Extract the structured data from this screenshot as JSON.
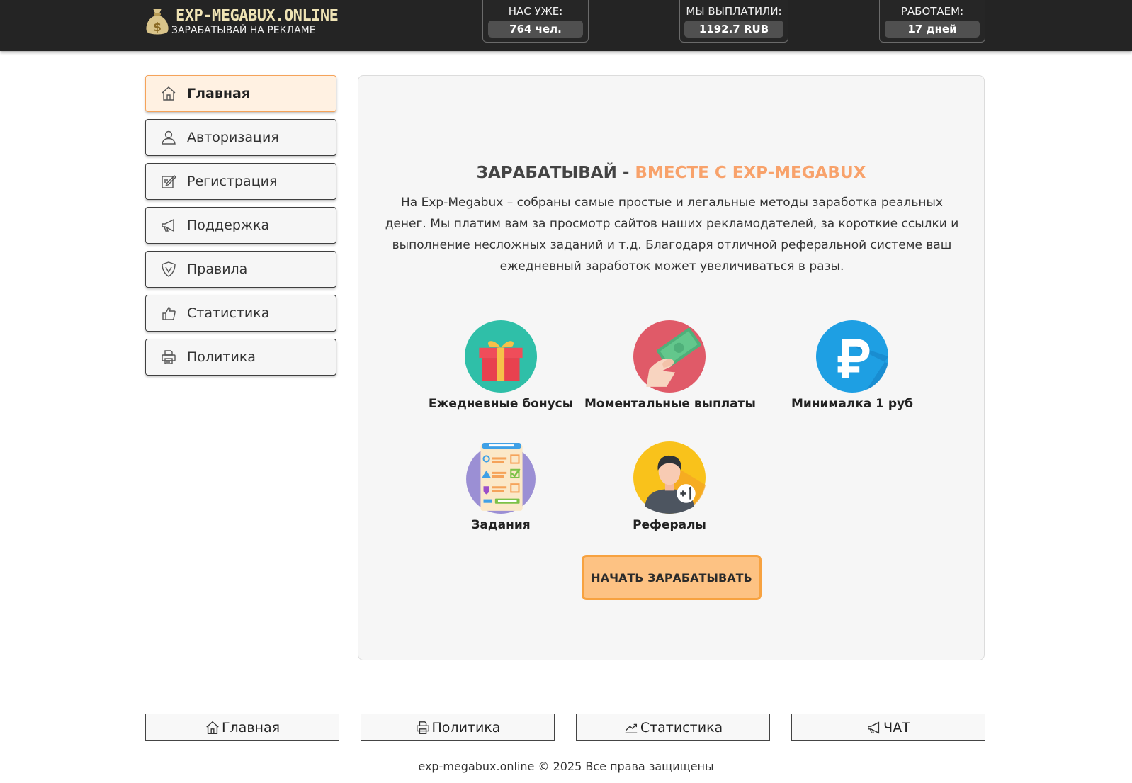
{
  "header": {
    "logo_title": "EXP-MEGABUX.ONLINE",
    "logo_subtitle": "ЗАРАБАТЫВАЙ НА РЕКЛАМЕ",
    "stats": [
      {
        "label": "НАС УЖЕ:",
        "value": "764 чел."
      },
      {
        "label": "МЫ ВЫПЛАТИЛИ:",
        "value": "1192.7 RUB"
      },
      {
        "label": "РАБОТАЕМ:",
        "value": "17 дней"
      }
    ]
  },
  "sidebar": {
    "items": [
      {
        "label": "Главная",
        "icon": "home-icon",
        "active": true
      },
      {
        "label": "Авторизация",
        "icon": "user-icon"
      },
      {
        "label": "Регистрация",
        "icon": "edit-icon"
      },
      {
        "label": "Поддержка",
        "icon": "megaphone-icon"
      },
      {
        "label": "Правила",
        "icon": "shield-icon"
      },
      {
        "label": "Статистика",
        "icon": "thumbs-up-icon"
      },
      {
        "label": "Политика",
        "icon": "printer-icon"
      }
    ]
  },
  "main": {
    "headline_dark": "ЗАРАБАТЫВАЙ - ",
    "headline_accent": "ВМЕСТЕ С EXP-MEGABUX",
    "intro": "На Exp-Megabux – собраны самые простые и легальные методы заработка реальных денег. Мы платим вам за просмотр сайтов наших рекламодателей, за короткие ссылки и выполнение несложных заданий и т.д. Благодаря отличной реферальной системе ваш ежедневный заработок может увеличиваться в разы.",
    "features": [
      {
        "label": "Ежедневные бонусы",
        "icon": "gift-icon"
      },
      {
        "label": "Моментальные выплаты",
        "icon": "cash-hand-icon"
      },
      {
        "label": "Минималка 1 руб",
        "icon": "ruble-icon"
      },
      {
        "label": "Задания",
        "icon": "checklist-icon"
      },
      {
        "label": "Рефералы",
        "icon": "referral-icon"
      }
    ],
    "cta_label": "НАЧАТЬ ЗАРАБАТЫВАТЬ"
  },
  "footer": {
    "links": [
      {
        "label": "Главная",
        "icon": "home-icon"
      },
      {
        "label": "Политика",
        "icon": "printer-icon"
      },
      {
        "label": "Статистика",
        "icon": "chart-icon"
      },
      {
        "label": "ЧАТ",
        "icon": "megaphone-icon"
      }
    ],
    "copyright": "exp-megabux.online © 2025 Все права защищены"
  },
  "colors": {
    "header_bg": "#242424",
    "accent_orange": "#f8a26b",
    "cta_bg": "#fdc283",
    "cta_border": "#f7a240",
    "active_nav_bg": "#fff1e2"
  }
}
